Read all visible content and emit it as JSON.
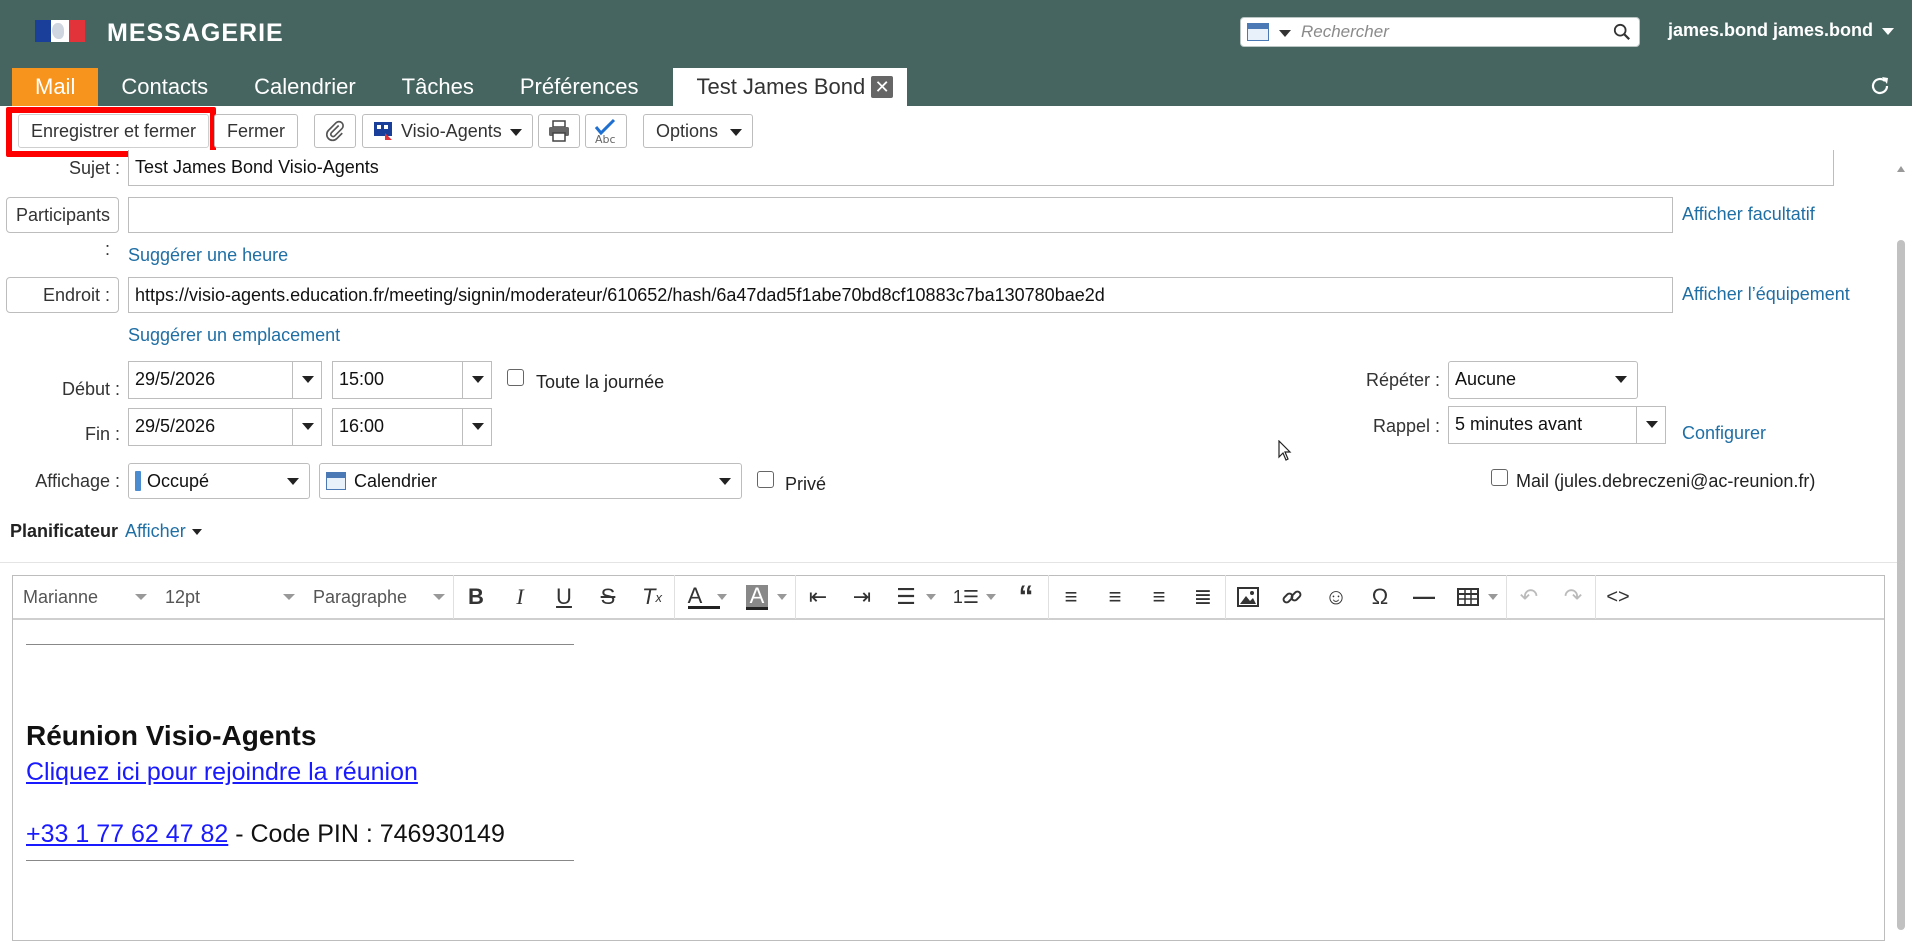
{
  "header": {
    "app_title": "MESSAGERIE",
    "search_placeholder": "Rechercher",
    "user_name": "james.bond james.bond"
  },
  "tabs": [
    {
      "label": "Mail"
    },
    {
      "label": "Contacts"
    },
    {
      "label": "Calendrier"
    },
    {
      "label": "Tâches"
    },
    {
      "label": "Préférences"
    },
    {
      "label": "Test James Bond"
    }
  ],
  "toolbar": {
    "save_close": "Enregistrer et fermer",
    "close": "Fermer",
    "visio": "Visio-Agents",
    "options": "Options"
  },
  "form": {
    "subject_label": "Sujet :",
    "subject_value": "Test James Bond Visio-Agents",
    "participants_label": "Participants :",
    "participants_value": "",
    "show_optional": "Afficher facultatif",
    "suggest_time": "Suggérer une heure",
    "location_label": "Endroit :",
    "location_value": "https://visio-agents.education.fr/meeting/signin/moderateur/610652/hash/6a47dad5f1abe70bd8cf10883c7ba130780bae2d",
    "show_equipment": "Afficher l’équipement",
    "suggest_location": "Suggérer un emplacement",
    "start_label": "Début :",
    "start_date": "29/5/2026",
    "start_time": "15:00",
    "all_day": "Toute la journée",
    "end_label": "Fin :",
    "end_date": "29/5/2026",
    "end_time": "16:00",
    "repeat_label": "Répéter :",
    "repeat_value": "Aucune",
    "reminder_label": "Rappel :",
    "reminder_value": "5 minutes avant",
    "configure": "Configurer",
    "display_label": "Affichage :",
    "display_value": "Occupé",
    "calendar_value": "Calendrier",
    "private": "Privé",
    "mail_notify": "Mail (jules.debreczeni@ac-reunion.fr)",
    "planner_label": "Planificateur",
    "planner_show": "Afficher"
  },
  "editor": {
    "font": "Marianne",
    "size": "12pt",
    "block": "Paragraphe",
    "meeting_title": "Réunion Visio-Agents",
    "join_link": "Cliquez ici pour rejoindre la réunion",
    "phone": "+33 1 77 62 47 82",
    "pin_text": " - Code PIN : 746930149"
  }
}
